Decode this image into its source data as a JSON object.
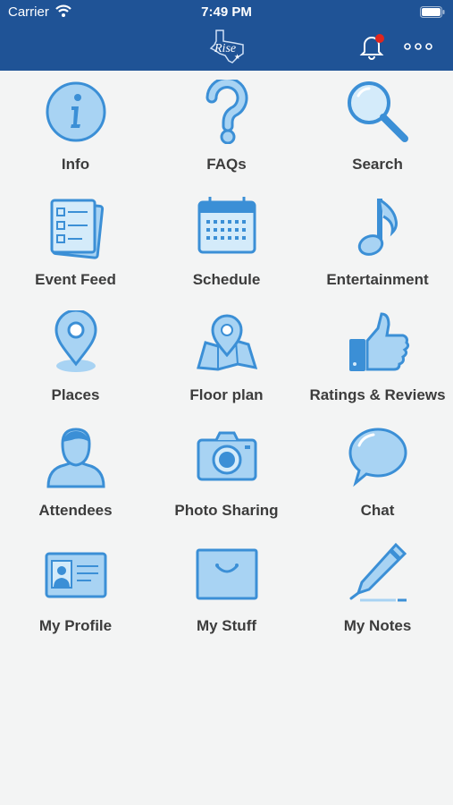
{
  "status_bar": {
    "carrier": "Carrier",
    "time": "7:49 PM"
  },
  "header": {
    "logo": "texas-rise-logo",
    "notification_badge": true
  },
  "colors": {
    "header_bg": "#1f5396",
    "icon_fill": "#a8d3f3",
    "icon_stroke": "#3b8fd6",
    "badge": "#e0261e"
  },
  "menu": [
    {
      "label": "Info",
      "icon": "info-icon"
    },
    {
      "label": "FAQs",
      "icon": "question-icon"
    },
    {
      "label": "Search",
      "icon": "magnifier-icon"
    },
    {
      "label": "Event Feed",
      "icon": "event-feed-icon"
    },
    {
      "label": "Schedule",
      "icon": "calendar-icon"
    },
    {
      "label": "Entertainment",
      "icon": "music-note-icon"
    },
    {
      "label": "Places",
      "icon": "map-pin-icon"
    },
    {
      "label": "Floor plan",
      "icon": "floor-plan-icon"
    },
    {
      "label": "Ratings & Reviews",
      "icon": "thumbs-up-icon"
    },
    {
      "label": "Attendees",
      "icon": "person-icon"
    },
    {
      "label": "Photo Sharing",
      "icon": "camera-icon"
    },
    {
      "label": "Chat",
      "icon": "speech-bubble-icon"
    },
    {
      "label": "My Profile",
      "icon": "id-card-icon"
    },
    {
      "label": "My Stuff",
      "icon": "bag-icon"
    },
    {
      "label": "My Notes",
      "icon": "pen-icon"
    }
  ]
}
